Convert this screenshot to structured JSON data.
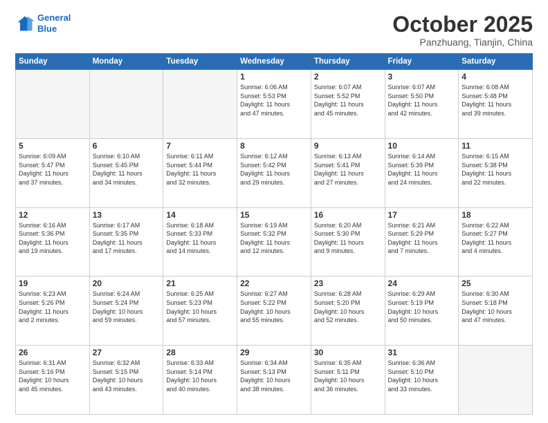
{
  "header": {
    "logo_line1": "General",
    "logo_line2": "Blue",
    "month": "October 2025",
    "location": "Panzhuang, Tianjin, China"
  },
  "weekdays": [
    "Sunday",
    "Monday",
    "Tuesday",
    "Wednesday",
    "Thursday",
    "Friday",
    "Saturday"
  ],
  "weeks": [
    [
      {
        "day": "",
        "info": ""
      },
      {
        "day": "",
        "info": ""
      },
      {
        "day": "",
        "info": ""
      },
      {
        "day": "1",
        "info": "Sunrise: 6:06 AM\nSunset: 5:53 PM\nDaylight: 11 hours\nand 47 minutes."
      },
      {
        "day": "2",
        "info": "Sunrise: 6:07 AM\nSunset: 5:52 PM\nDaylight: 11 hours\nand 45 minutes."
      },
      {
        "day": "3",
        "info": "Sunrise: 6:07 AM\nSunset: 5:50 PM\nDaylight: 11 hours\nand 42 minutes."
      },
      {
        "day": "4",
        "info": "Sunrise: 6:08 AM\nSunset: 5:48 PM\nDaylight: 11 hours\nand 39 minutes."
      }
    ],
    [
      {
        "day": "5",
        "info": "Sunrise: 6:09 AM\nSunset: 5:47 PM\nDaylight: 11 hours\nand 37 minutes."
      },
      {
        "day": "6",
        "info": "Sunrise: 6:10 AM\nSunset: 5:45 PM\nDaylight: 11 hours\nand 34 minutes."
      },
      {
        "day": "7",
        "info": "Sunrise: 6:11 AM\nSunset: 5:44 PM\nDaylight: 11 hours\nand 32 minutes."
      },
      {
        "day": "8",
        "info": "Sunrise: 6:12 AM\nSunset: 5:42 PM\nDaylight: 11 hours\nand 29 minutes."
      },
      {
        "day": "9",
        "info": "Sunrise: 6:13 AM\nSunset: 5:41 PM\nDaylight: 11 hours\nand 27 minutes."
      },
      {
        "day": "10",
        "info": "Sunrise: 6:14 AM\nSunset: 5:39 PM\nDaylight: 11 hours\nand 24 minutes."
      },
      {
        "day": "11",
        "info": "Sunrise: 6:15 AM\nSunset: 5:38 PM\nDaylight: 11 hours\nand 22 minutes."
      }
    ],
    [
      {
        "day": "12",
        "info": "Sunrise: 6:16 AM\nSunset: 5:36 PM\nDaylight: 11 hours\nand 19 minutes."
      },
      {
        "day": "13",
        "info": "Sunrise: 6:17 AM\nSunset: 5:35 PM\nDaylight: 11 hours\nand 17 minutes."
      },
      {
        "day": "14",
        "info": "Sunrise: 6:18 AM\nSunset: 5:33 PM\nDaylight: 11 hours\nand 14 minutes."
      },
      {
        "day": "15",
        "info": "Sunrise: 6:19 AM\nSunset: 5:32 PM\nDaylight: 11 hours\nand 12 minutes."
      },
      {
        "day": "16",
        "info": "Sunrise: 6:20 AM\nSunset: 5:30 PM\nDaylight: 11 hours\nand 9 minutes."
      },
      {
        "day": "17",
        "info": "Sunrise: 6:21 AM\nSunset: 5:29 PM\nDaylight: 11 hours\nand 7 minutes."
      },
      {
        "day": "18",
        "info": "Sunrise: 6:22 AM\nSunset: 5:27 PM\nDaylight: 11 hours\nand 4 minutes."
      }
    ],
    [
      {
        "day": "19",
        "info": "Sunrise: 6:23 AM\nSunset: 5:26 PM\nDaylight: 11 hours\nand 2 minutes."
      },
      {
        "day": "20",
        "info": "Sunrise: 6:24 AM\nSunset: 5:24 PM\nDaylight: 10 hours\nand 59 minutes."
      },
      {
        "day": "21",
        "info": "Sunrise: 6:25 AM\nSunset: 5:23 PM\nDaylight: 10 hours\nand 57 minutes."
      },
      {
        "day": "22",
        "info": "Sunrise: 6:27 AM\nSunset: 5:22 PM\nDaylight: 10 hours\nand 55 minutes."
      },
      {
        "day": "23",
        "info": "Sunrise: 6:28 AM\nSunset: 5:20 PM\nDaylight: 10 hours\nand 52 minutes."
      },
      {
        "day": "24",
        "info": "Sunrise: 6:29 AM\nSunset: 5:19 PM\nDaylight: 10 hours\nand 50 minutes."
      },
      {
        "day": "25",
        "info": "Sunrise: 6:30 AM\nSunset: 5:18 PM\nDaylight: 10 hours\nand 47 minutes."
      }
    ],
    [
      {
        "day": "26",
        "info": "Sunrise: 6:31 AM\nSunset: 5:16 PM\nDaylight: 10 hours\nand 45 minutes."
      },
      {
        "day": "27",
        "info": "Sunrise: 6:32 AM\nSunset: 5:15 PM\nDaylight: 10 hours\nand 43 minutes."
      },
      {
        "day": "28",
        "info": "Sunrise: 6:33 AM\nSunset: 5:14 PM\nDaylight: 10 hours\nand 40 minutes."
      },
      {
        "day": "29",
        "info": "Sunrise: 6:34 AM\nSunset: 5:13 PM\nDaylight: 10 hours\nand 38 minutes."
      },
      {
        "day": "30",
        "info": "Sunrise: 6:35 AM\nSunset: 5:11 PM\nDaylight: 10 hours\nand 36 minutes."
      },
      {
        "day": "31",
        "info": "Sunrise: 6:36 AM\nSunset: 5:10 PM\nDaylight: 10 hours\nand 33 minutes."
      },
      {
        "day": "",
        "info": ""
      }
    ]
  ]
}
